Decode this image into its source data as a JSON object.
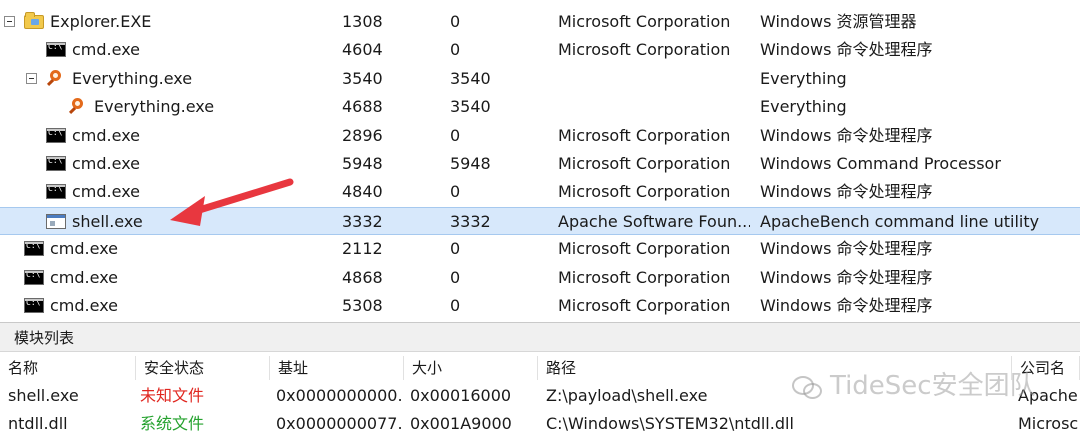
{
  "processes": [
    {
      "name": "Explorer.EXE",
      "pid": "1308",
      "ppid": "0",
      "company": "Microsoft Corporation",
      "desc": "Windows 资源管理器",
      "icon": "folder-icon",
      "depth": 0,
      "toggle": true
    },
    {
      "name": "cmd.exe",
      "pid": "4604",
      "ppid": "0",
      "company": "Microsoft Corporation",
      "desc": "Windows 命令处理程序",
      "icon": "cmd-icon",
      "depth": 1,
      "toggle": false
    },
    {
      "name": "Everything.exe",
      "pid": "3540",
      "ppid": "3540",
      "company": "",
      "desc": "Everything",
      "icon": "search-icon",
      "depth": 1,
      "toggle": true
    },
    {
      "name": "Everything.exe",
      "pid": "4688",
      "ppid": "3540",
      "company": "",
      "desc": "Everything",
      "icon": "search-icon",
      "depth": 2,
      "toggle": false
    },
    {
      "name": "cmd.exe",
      "pid": "2896",
      "ppid": "0",
      "company": "Microsoft Corporation",
      "desc": "Windows 命令处理程序",
      "icon": "cmd-icon",
      "depth": 1,
      "toggle": false
    },
    {
      "name": "cmd.exe",
      "pid": "5948",
      "ppid": "5948",
      "company": "Microsoft Corporation",
      "desc": "Windows Command Processor",
      "icon": "cmd-icon",
      "depth": 1,
      "toggle": false
    },
    {
      "name": "cmd.exe",
      "pid": "4840",
      "ppid": "0",
      "company": "Microsoft Corporation",
      "desc": "Windows 命令处理程序",
      "icon": "cmd-icon",
      "depth": 1,
      "toggle": false
    },
    {
      "name": "shell.exe",
      "pid": "3332",
      "ppid": "3332",
      "company": "Apache Software Foun...",
      "desc": "ApacheBench command line utility",
      "icon": "app-window-icon",
      "depth": 1,
      "toggle": false,
      "selected": true
    },
    {
      "name": "cmd.exe",
      "pid": "2112",
      "ppid": "0",
      "company": "Microsoft Corporation",
      "desc": "Windows 命令处理程序",
      "icon": "cmd-icon",
      "depth": 0,
      "toggle": false
    },
    {
      "name": "cmd.exe",
      "pid": "4868",
      "ppid": "0",
      "company": "Microsoft Corporation",
      "desc": "Windows 命令处理程序",
      "icon": "cmd-icon",
      "depth": 0,
      "toggle": false
    },
    {
      "name": "cmd.exe",
      "pid": "5308",
      "ppid": "0",
      "company": "Microsoft Corporation",
      "desc": "Windows 命令处理程序",
      "icon": "cmd-icon",
      "depth": 0,
      "toggle": false
    }
  ],
  "modules": {
    "title": "模块列表",
    "columns": [
      "名称",
      "安全状态",
      "基址",
      "大小",
      "路径",
      "公司名"
    ],
    "rows": [
      {
        "name": "shell.exe",
        "status": "未知文件",
        "status_color": "#e0261f",
        "base": "0x0000000000...",
        "size": "0x00016000",
        "path": "Z:\\payload\\shell.exe",
        "company": "Apache"
      },
      {
        "name": "ntdll.dll",
        "status": "系统文件",
        "status_color": "#25a22e",
        "base": "0x0000000077...",
        "size": "0x001A9000",
        "path": "C:\\Windows\\SYSTEM32\\ntdll.dll",
        "company": "Microsc"
      }
    ]
  },
  "watermark": "TideSec安全团队",
  "colors": {
    "selected_row": "#d7e8fb",
    "annotation_arrow": "#e8373f"
  }
}
